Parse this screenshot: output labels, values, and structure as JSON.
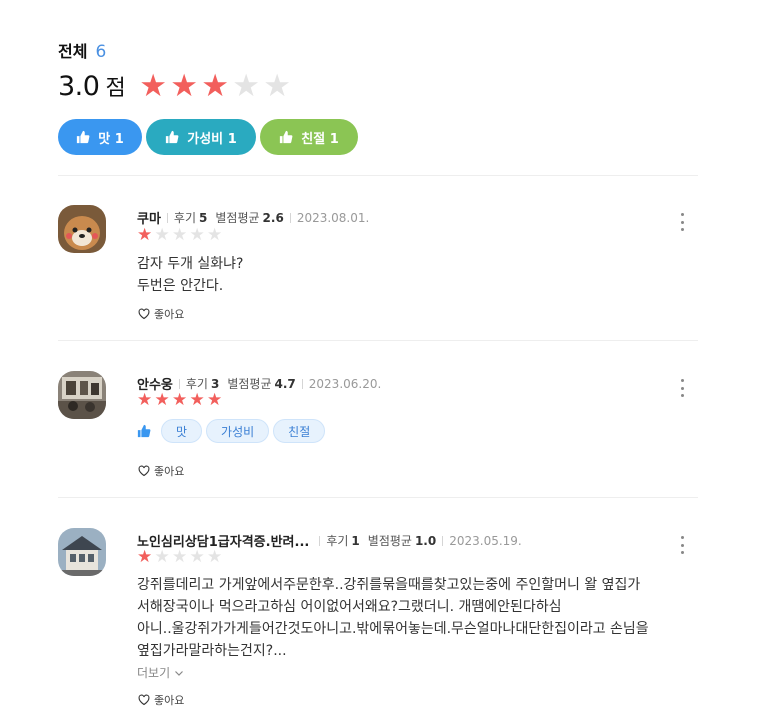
{
  "summary": {
    "total_label": "전체",
    "total_count": "6",
    "score": "3.0",
    "score_unit": "점",
    "rating": 3,
    "max_rating": 5,
    "chips": [
      {
        "label": "맛",
        "count": "1",
        "color": "#3a97f0",
        "icon": "thumbs-up-icon"
      },
      {
        "label": "가성비",
        "count": "1",
        "color": "#2aaac0",
        "icon": "thumbs-up-icon"
      },
      {
        "label": "친절",
        "count": "1",
        "color": "#8bc554",
        "icon": "thumbs-up-icon"
      }
    ]
  },
  "reviews": [
    {
      "name": "쿠마",
      "review_label": "후기",
      "review_count": "5",
      "avg_label": "별점평균",
      "avg": "2.6",
      "date": "2023.08.01.",
      "rating": 1,
      "text_lines": [
        "감자 두개 실화냐?",
        "두번은 안간다."
      ],
      "like_label": "좋아요",
      "avatar": "shiba-dog-photo"
    },
    {
      "name": "안수웅",
      "review_label": "후기",
      "review_count": "3",
      "avg_label": "별점평균",
      "avg": "4.7",
      "date": "2023.06.20.",
      "rating": 5,
      "tags": [
        "맛",
        "가성비",
        "친절"
      ],
      "like_label": "좋아요",
      "avatar": "room-photo"
    },
    {
      "name": "노인심리상담1급자격증.반려...",
      "review_label": "후기",
      "review_count": "1",
      "avg_label": "별점평균",
      "avg": "1.0",
      "date": "2023.05.19.",
      "rating": 1,
      "text_lines": [
        "강쥐를데리고 가게앞에서주문한후..강쥐를묶을때를찾고있는중에 주인할머니 왈 옆집가",
        "서해장국이나 먹으라고하심 어이없어서왜요?그랬더니. 개땜에안된다하심",
        "아니..울강쥐가가게들어간것도아니고.밖에묶어놓는데.무슨얼마나대단한집이라고 손님을",
        "옆집가라말라하는건지?..."
      ],
      "show_more_label": "더보기",
      "like_label": "좋아요",
      "avatar": "building-photo"
    }
  ]
}
